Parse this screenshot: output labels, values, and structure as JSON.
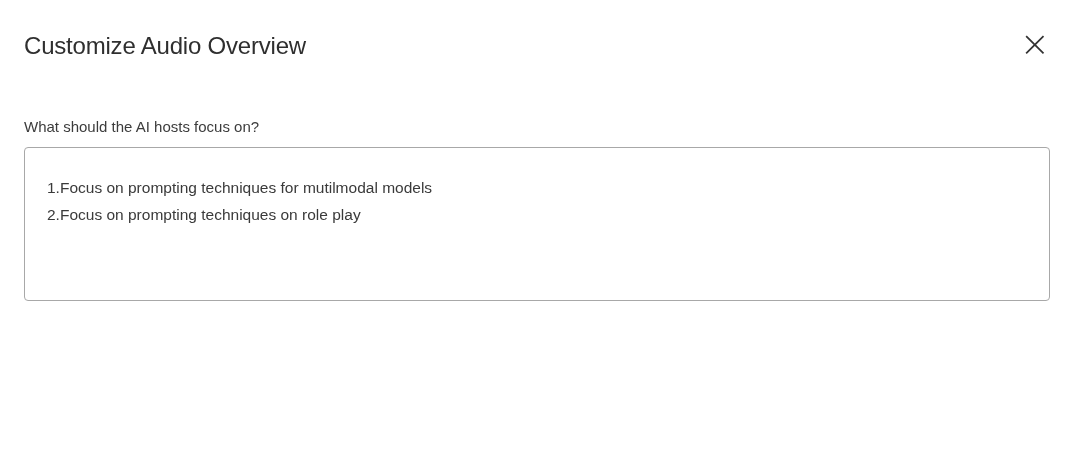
{
  "dialog": {
    "title": "Customize Audio Overview",
    "close_label": "×"
  },
  "focus_field": {
    "label": "What should the AI hosts focus on?",
    "value": "1.Focus on prompting techniques for mutilmodal models\n2.Focus on prompting techniques on role play"
  }
}
